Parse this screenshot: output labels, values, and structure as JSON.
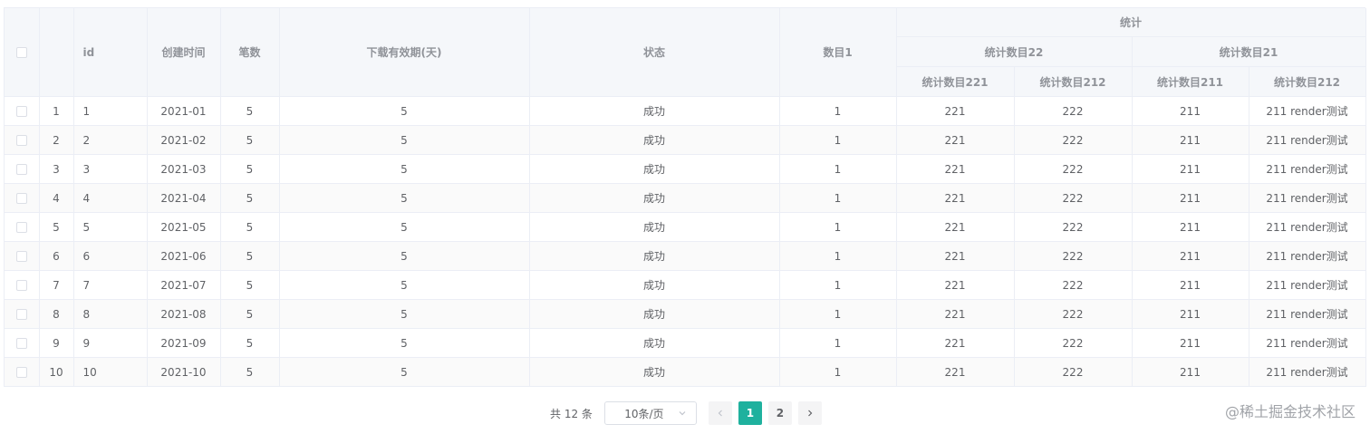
{
  "table": {
    "headers": {
      "id": "id",
      "created": "创建时间",
      "count": "笔数",
      "download_valid": "下载有效期(天)",
      "status": "状态",
      "num1": "数目1",
      "stats": "统计",
      "stats22": "统计数目22",
      "stats21": "统计数目21",
      "stats221": "统计数目221",
      "stats222": "统计数目212",
      "stats211": "统计数目211",
      "stats212": "统计数目212"
    },
    "rows": [
      {
        "index": "1",
        "id": "1",
        "created": "2021-01",
        "count": "5",
        "download_valid": "5",
        "status": "成功",
        "num1": "1",
        "s221": "221",
        "s222": "222",
        "s211": "211",
        "s212": "211 render测试"
      },
      {
        "index": "2",
        "id": "2",
        "created": "2021-02",
        "count": "5",
        "download_valid": "5",
        "status": "成功",
        "num1": "1",
        "s221": "221",
        "s222": "222",
        "s211": "211",
        "s212": "211 render测试"
      },
      {
        "index": "3",
        "id": "3",
        "created": "2021-03",
        "count": "5",
        "download_valid": "5",
        "status": "成功",
        "num1": "1",
        "s221": "221",
        "s222": "222",
        "s211": "211",
        "s212": "211 render测试"
      },
      {
        "index": "4",
        "id": "4",
        "created": "2021-04",
        "count": "5",
        "download_valid": "5",
        "status": "成功",
        "num1": "1",
        "s221": "221",
        "s222": "222",
        "s211": "211",
        "s212": "211 render测试"
      },
      {
        "index": "5",
        "id": "5",
        "created": "2021-05",
        "count": "5",
        "download_valid": "5",
        "status": "成功",
        "num1": "1",
        "s221": "221",
        "s222": "222",
        "s211": "211",
        "s212": "211 render测试"
      },
      {
        "index": "6",
        "id": "6",
        "created": "2021-06",
        "count": "5",
        "download_valid": "5",
        "status": "成功",
        "num1": "1",
        "s221": "221",
        "s222": "222",
        "s211": "211",
        "s212": "211 render测试"
      },
      {
        "index": "7",
        "id": "7",
        "created": "2021-07",
        "count": "5",
        "download_valid": "5",
        "status": "成功",
        "num1": "1",
        "s221": "221",
        "s222": "222",
        "s211": "211",
        "s212": "211 render测试"
      },
      {
        "index": "8",
        "id": "8",
        "created": "2021-08",
        "count": "5",
        "download_valid": "5",
        "status": "成功",
        "num1": "1",
        "s221": "221",
        "s222": "222",
        "s211": "211",
        "s212": "211 render测试"
      },
      {
        "index": "9",
        "id": "9",
        "created": "2021-09",
        "count": "5",
        "download_valid": "5",
        "status": "成功",
        "num1": "1",
        "s221": "221",
        "s222": "222",
        "s211": "211",
        "s212": "211 render测试"
      },
      {
        "index": "10",
        "id": "10",
        "created": "2021-10",
        "count": "5",
        "download_valid": "5",
        "status": "成功",
        "num1": "1",
        "s221": "221",
        "s222": "222",
        "s211": "211",
        "s212": "211 render测试"
      }
    ]
  },
  "pagination": {
    "total_text": "共 12 条",
    "page_size": "10条/页",
    "pages": [
      "1",
      "2"
    ],
    "current_page": "1",
    "prev_icon": "chevron-left-icon",
    "next_icon": "chevron-right-icon",
    "dropdown_icon": "chevron-down-icon",
    "accent_color": "#1fb19e"
  },
  "watermark": "@稀土掘金技术社区"
}
